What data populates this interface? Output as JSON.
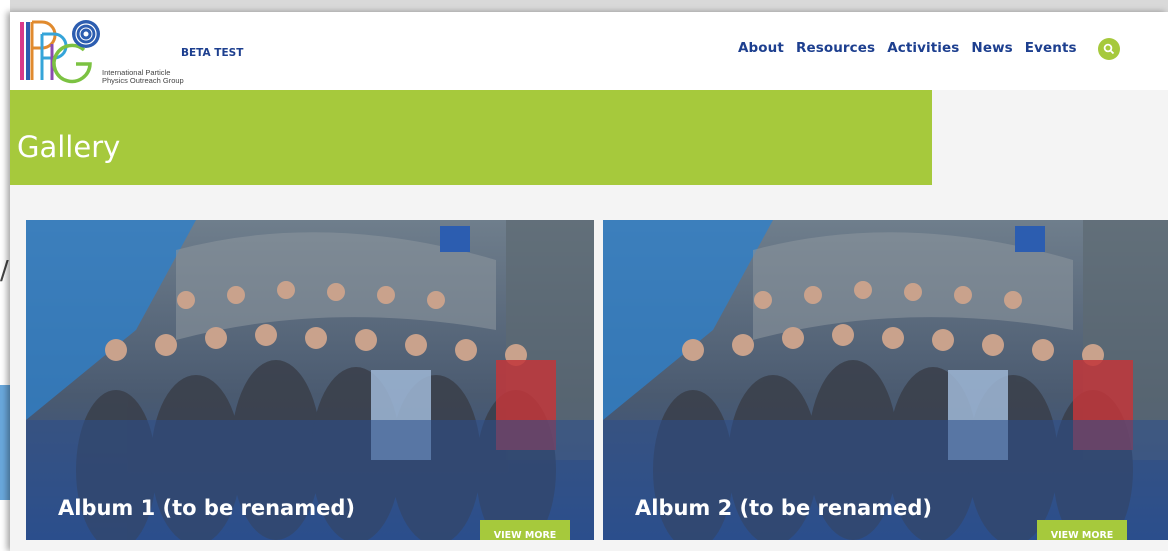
{
  "site": {
    "logo_text": "IPPOG",
    "org_name_line1": "International Particle",
    "org_name_line2": "Physics Outreach Group",
    "beta_label": "BETA TEST"
  },
  "nav": {
    "items": [
      {
        "label": "About"
      },
      {
        "label": "Resources"
      },
      {
        "label": "Activities"
      },
      {
        "label": "News"
      },
      {
        "label": "Events"
      }
    ],
    "search_icon": "search-icon"
  },
  "banner": {
    "title": "Gallery"
  },
  "albums": [
    {
      "title": "Album 1 (to be renamed)",
      "button": "VIEW MORE"
    },
    {
      "title": "Album 2 (to be renamed)",
      "button": "VIEW MORE"
    }
  ],
  "colors": {
    "brand_green": "#a6c93c",
    "nav_blue": "#1d3f8f",
    "card_overlay": "#2c4e85"
  }
}
